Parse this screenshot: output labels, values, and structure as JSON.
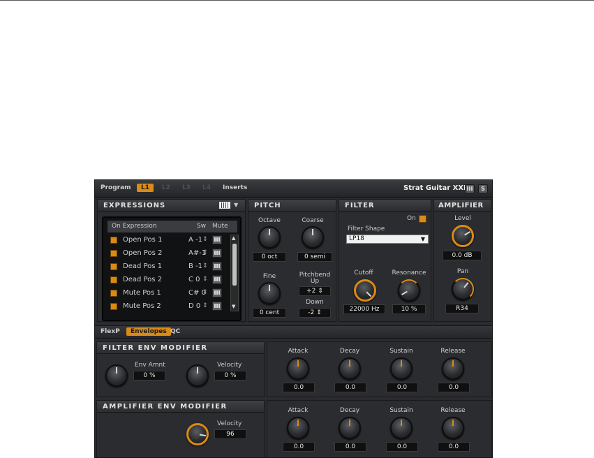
{
  "app": {
    "title": "Strat Guitar XXL",
    "tabs": [
      "Program",
      "L1",
      "L2",
      "L3",
      "L4",
      "Inserts"
    ],
    "active_tab": "L1",
    "btn_keys": "III",
    "btn_s": "S"
  },
  "expressions": {
    "title": "EXPRESSIONS",
    "keyboard_icon": "piano-keys-icon",
    "col_on": "On Expression",
    "col_sw": "Sw",
    "col_mute": "Mute",
    "mute_glyph": "III",
    "rows": [
      {
        "name": "Open Pos 1",
        "key": "A -1"
      },
      {
        "name": "Open Pos 2",
        "key": "A#-1"
      },
      {
        "name": "Dead Pos 1",
        "key": "B -1"
      },
      {
        "name": "Dead Pos 2",
        "key": "C 0"
      },
      {
        "name": "Mute Pos 1",
        "key": "C# 0"
      },
      {
        "name": "Mute Pos 2",
        "key": "D 0"
      }
    ]
  },
  "pitch": {
    "title": "PITCH",
    "octave_label": "Octave",
    "octave_value": "0 oct",
    "coarse_label": "Coarse",
    "coarse_value": "0 semi",
    "fine_label": "Fine",
    "fine_value": "0 cent",
    "pitchbend_label": "Pitchbend",
    "up_label": "Up",
    "up_value": "+2",
    "down_label": "Down",
    "down_value": "-2"
  },
  "filter": {
    "title": "FILTER",
    "on_label": "On",
    "shape_label": "Filter Shape",
    "shape_value": "LP18",
    "cutoff_label": "Cutoff",
    "cutoff_value": "22000 Hz",
    "resonance_label": "Resonance",
    "resonance_value": "10 %"
  },
  "amplifier": {
    "title": "AMPLIFIER",
    "level_label": "Level",
    "level_value": "0.0 dB",
    "pan_label": "Pan",
    "pan_value": "R34"
  },
  "subtabs": {
    "items": [
      "FlexP",
      "Envelopes",
      "QC"
    ],
    "active": "Envelopes"
  },
  "filter_env": {
    "title": "FILTER ENV MODIFIER",
    "env_amnt_label": "Env Amnt",
    "env_amnt_value": "0 %",
    "velocity_label": "Velocity",
    "velocity_value": "0 %",
    "attack_label": "Attack",
    "attack_value": "0.0",
    "decay_label": "Decay",
    "decay_value": "0.0",
    "sustain_label": "Sustain",
    "sustain_value": "0.0",
    "release_label": "Release",
    "release_value": "0.0"
  },
  "amp_env": {
    "title": "AMPLIFIER ENV MODIFIER",
    "velocity_label": "Velocity",
    "velocity_value": "96",
    "attack_label": "Attack",
    "attack_value": "0.0",
    "decay_label": "Decay",
    "decay_value": "0.0",
    "sustain_label": "Sustain",
    "sustain_value": "0.0",
    "release_label": "Release",
    "release_value": "0.0"
  },
  "colors": {
    "accent": "#d98a17",
    "panel": "#2b2c2f",
    "text": "#c9c9c9"
  }
}
